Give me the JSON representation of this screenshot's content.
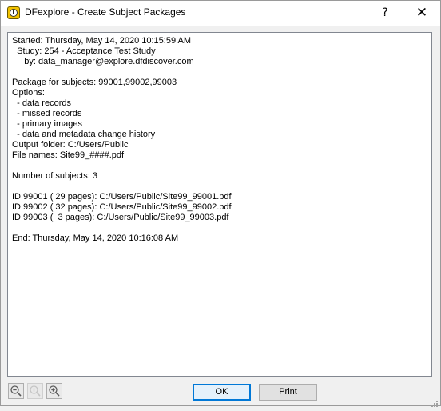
{
  "window": {
    "title": "DFexplore - Create Subject Packages",
    "help_label": "?",
    "close_label": "✕"
  },
  "log": {
    "lines": [
      "Started: Thursday, May 14, 2020 10:15:59 AM",
      "  Study: 254 - Acceptance Test Study",
      "     by: data_manager@explore.dfdiscover.com",
      "",
      "Package for subjects: 99001,99002,99003",
      "Options:",
      "  - data records",
      "  - missed records",
      "  - primary images",
      "  - data and metadata change history",
      "Output folder: C:/Users/Public",
      "File names: Site99_####.pdf",
      "",
      "Number of subjects: 3",
      "",
      "ID 99001 ( 29 pages): C:/Users/Public/Site99_99001.pdf",
      "ID 99002 ( 32 pages): C:/Users/Public/Site99_99002.pdf",
      "ID 99003 (  3 pages): C:/Users/Public/Site99_99003.pdf",
      "",
      "End: Thursday, May 14, 2020 10:16:08 AM"
    ]
  },
  "toolbar": {
    "ok_label": "OK",
    "print_label": "Print"
  },
  "icons": {
    "zoom_out": "zoom-out-icon",
    "zoom_reset": "zoom-reset-icon",
    "zoom_in": "zoom-in-icon"
  },
  "colors": {
    "accent": "#0078d7",
    "titlebar": "#ffffff",
    "dialog_bg": "#f0f0f0"
  }
}
